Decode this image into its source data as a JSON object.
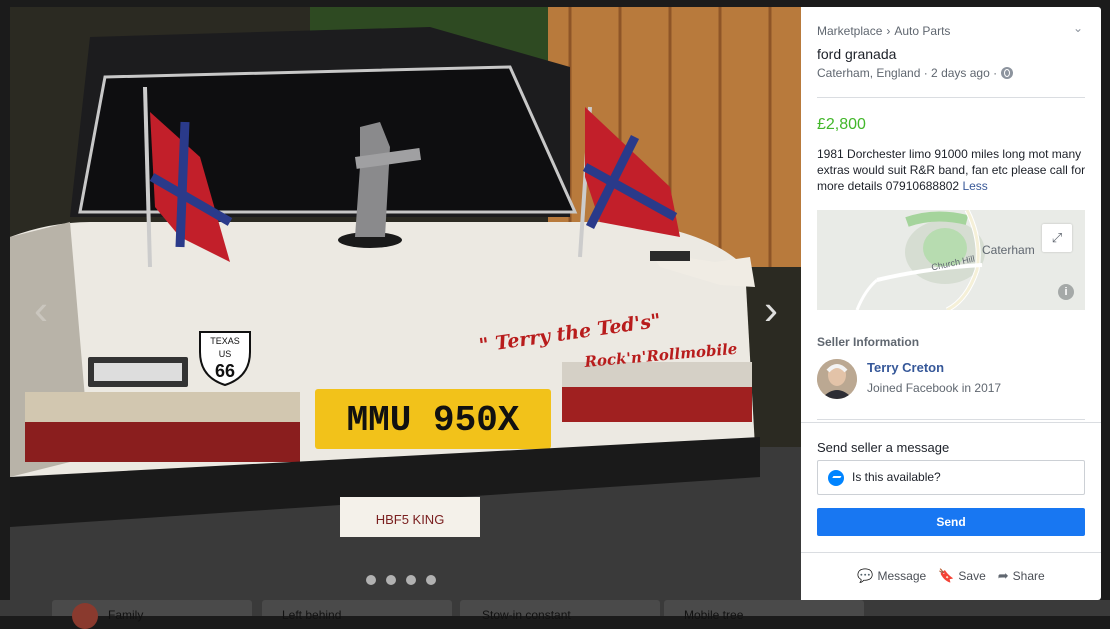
{
  "background": {
    "tabs": [
      "Family",
      "Left behind",
      "Stow-in constant",
      "Mobile tree"
    ]
  },
  "viewer": {
    "prev_glyph": "‹",
    "next_glyph": "›",
    "photo": {
      "plate": "MMU 950X",
      "decal_line1": "\" Terry the Ted's\"",
      "decal_line2": "Rock'n'Rollmobile",
      "shield_top": "TEXAS",
      "shield_mid": "US",
      "shield_num": "66",
      "lower_plate": "HBF5 KING"
    },
    "dots": 4
  },
  "listing": {
    "breadcrumb": [
      "Marketplace",
      "Auto Parts"
    ],
    "breadcrumb_sep": "›",
    "collapse_glyph": "⌄",
    "title": "ford granada",
    "location": "Caterham, England · 2 days ago ·",
    "price": "£2,800",
    "description": "1981 Dorchester limo 91000 miles long mot many extras would suit R&R band, fan etc please call for more details 07910688802",
    "less_link": "Less"
  },
  "map": {
    "town": "Caterham",
    "street": "Church Hill",
    "expand_glyph": "⤢",
    "info_glyph": "i"
  },
  "seller": {
    "heading": "Seller Information",
    "name": "Terry Creton",
    "joined": "Joined Facebook in 2017"
  },
  "message": {
    "heading": "Send seller a message",
    "input_value": "Is this available?",
    "send_label": "Send"
  },
  "actions": [
    {
      "icon": "messenger-icon",
      "glyph": "💬",
      "label": "Message"
    },
    {
      "icon": "bookmark-icon",
      "glyph": "🔖",
      "label": "Save"
    },
    {
      "icon": "share-icon",
      "glyph": "➦",
      "label": "Share"
    }
  ],
  "colors": {
    "price": "#42b72a",
    "link": "#385898",
    "send": "#1877f2"
  }
}
